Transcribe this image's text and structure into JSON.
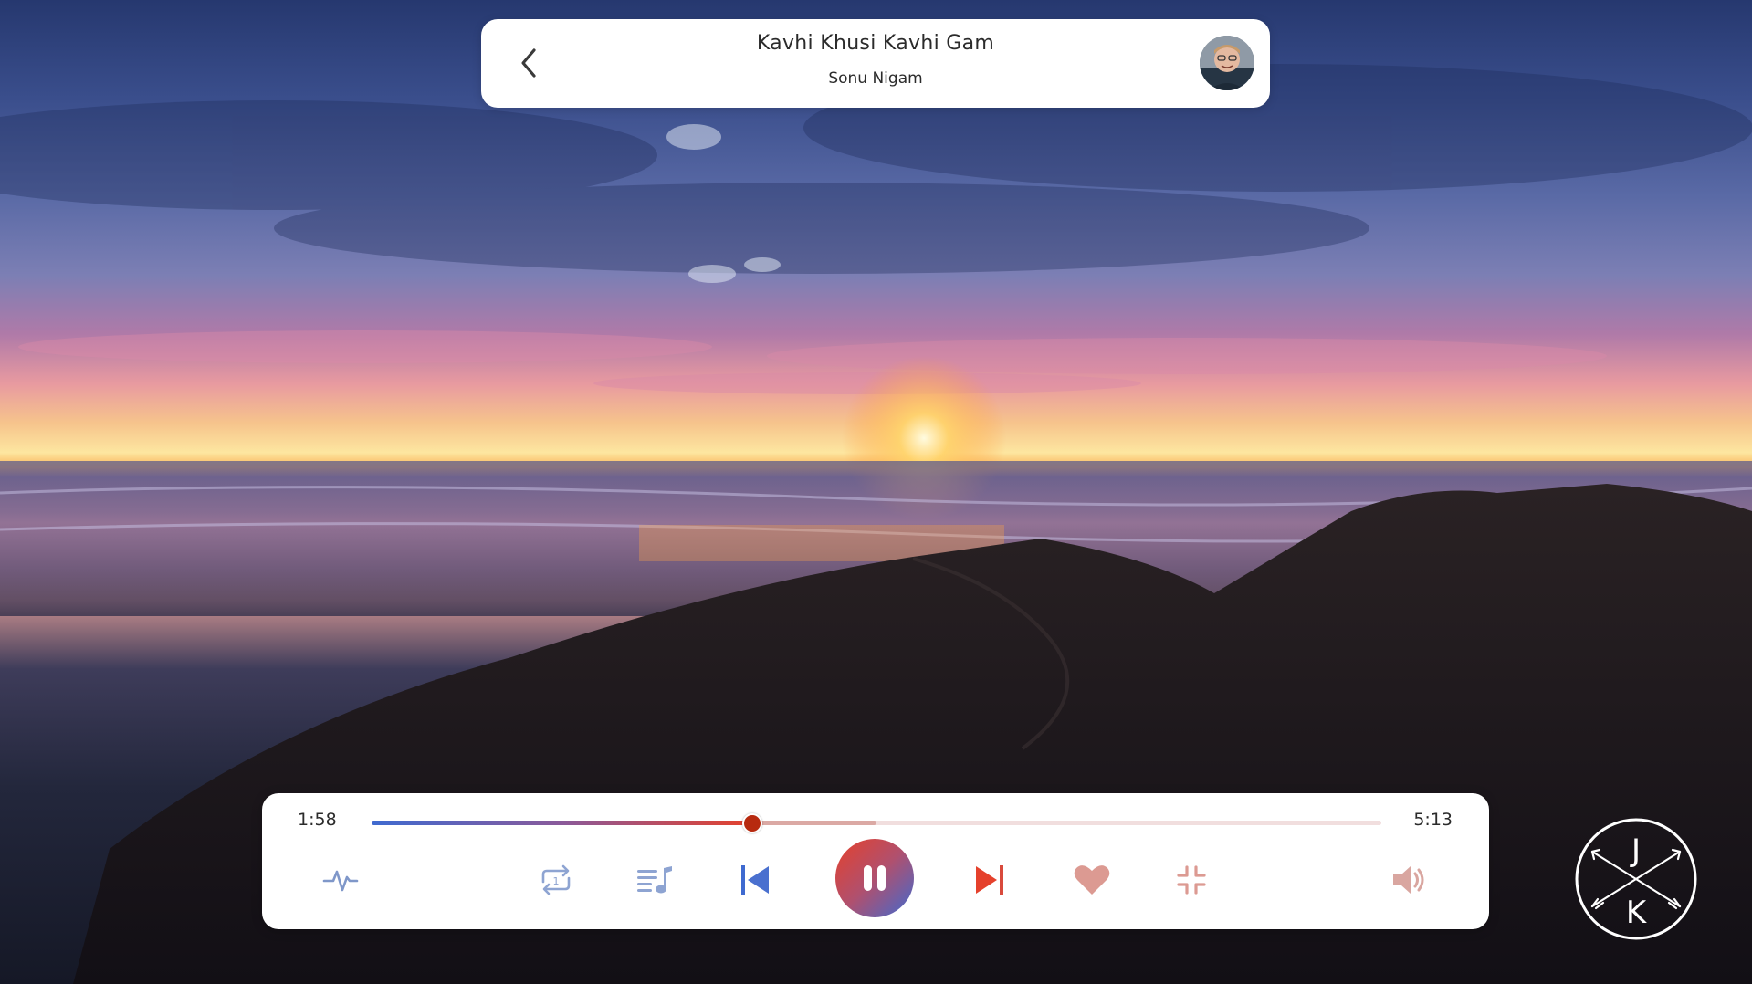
{
  "header": {
    "title": "Kavhi Khusi Kavhi Gam",
    "artist": "Sonu Nigam",
    "back_icon": "chevron-left-icon",
    "avatar_icon": "artist-avatar"
  },
  "player": {
    "current_time": "1:58",
    "total_time": "5:13",
    "progress_fraction": 0.377,
    "buffered_fraction": 0.5,
    "controls": [
      {
        "name": "equalizer-icon",
        "color": "#7f97c9"
      },
      {
        "name": "repeat-one-icon",
        "color": "#8ea4d2"
      },
      {
        "name": "playlist-icon",
        "color": "#8ea4d2"
      },
      {
        "name": "previous-icon",
        "color": "#3f6ad0"
      },
      {
        "name": "pause-icon",
        "color": "#ffffff"
      },
      {
        "name": "next-icon",
        "color": "#e5412c"
      },
      {
        "name": "heart-icon",
        "color": "#dc9a92"
      },
      {
        "name": "minimize-icon",
        "color": "#dc9a92"
      },
      {
        "name": "volume-icon",
        "color": "#d9a6a0"
      }
    ]
  },
  "logo": {
    "top_letter": "J",
    "bottom_letter": "K"
  },
  "colors": {
    "accent_blue": "#3f6ad0",
    "accent_red": "#e5412c",
    "thumb": "#b72a0f",
    "card": "#ffffff",
    "text": "#2b2b2b"
  }
}
